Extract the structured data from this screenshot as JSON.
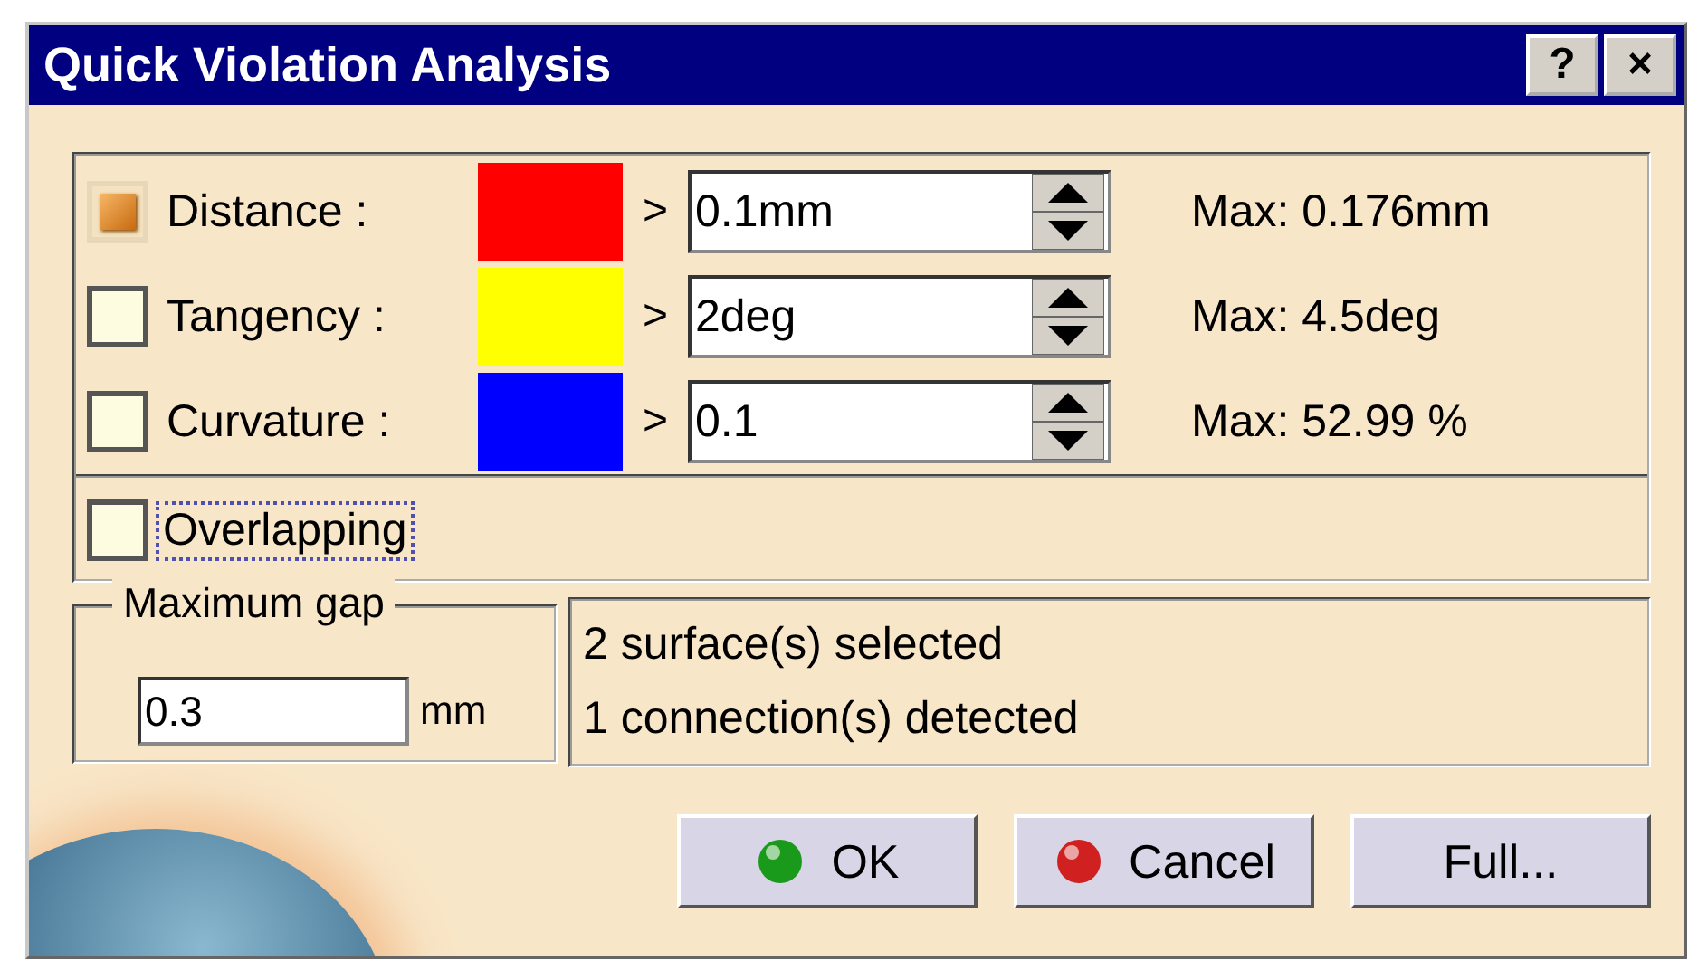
{
  "window": {
    "title": "Quick Violation Analysis",
    "title_buttons": [
      "?",
      "×"
    ]
  },
  "criteria": [
    {
      "label": "Distance :",
      "checked": true,
      "color": "#ff0000",
      "operator": ">",
      "value": "0.1mm",
      "max": "Max: 0.176mm"
    },
    {
      "label": "Tangency :",
      "checked": false,
      "color": "#ffff00",
      "operator": ">",
      "value": "2deg",
      "max": "Max: 4.5deg"
    },
    {
      "label": "Curvature :",
      "checked": false,
      "color": "#0000ff",
      "operator": ">",
      "value": "0.1",
      "max": "Max:  52.99 %"
    }
  ],
  "overlapping": {
    "label": "Overlapping",
    "checked": false,
    "focused": true
  },
  "maximum_gap": {
    "title": "Maximum gap",
    "value": "0.3",
    "unit": "mm"
  },
  "status": [
    "2 surface(s) selected",
    "1 connection(s) detected"
  ],
  "buttons": [
    {
      "label": "OK",
      "kind": "ok"
    },
    {
      "label": "Cancel",
      "kind": "cancel"
    },
    {
      "label": "Full...",
      "kind": "plain"
    }
  ]
}
